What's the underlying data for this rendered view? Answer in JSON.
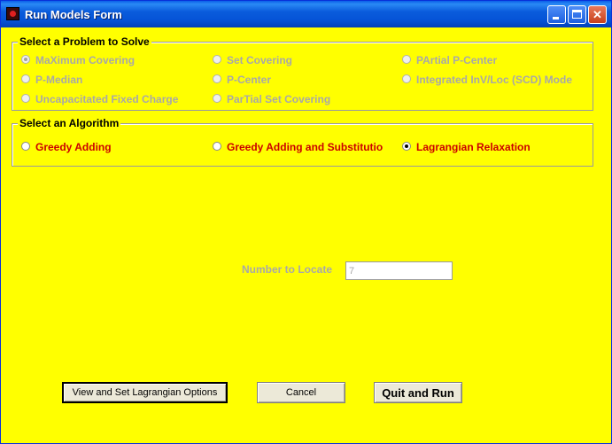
{
  "window": {
    "title": "Run Models Form"
  },
  "problem_group": {
    "legend": "Select a Problem to Solve",
    "options": [
      {
        "label": "MaXimum Covering",
        "checked": true
      },
      {
        "label": "Set Covering",
        "checked": false
      },
      {
        "label": "PArtial P-Center",
        "checked": false
      },
      {
        "label": "P-Median",
        "checked": false
      },
      {
        "label": "P-Center",
        "checked": false
      },
      {
        "label": "Integrated InV/Loc (SCD) Mode",
        "checked": false
      },
      {
        "label": "Uncapacitated Fixed Charge",
        "checked": false
      },
      {
        "label": "ParTial Set Covering",
        "checked": false
      }
    ]
  },
  "algorithm_group": {
    "legend": "Select an Algorithm",
    "options": [
      {
        "label": "Greedy Adding",
        "checked": false
      },
      {
        "label": "Greedy Adding and Substitutio",
        "checked": false
      },
      {
        "label": "Lagrangian Relaxation",
        "checked": true
      }
    ]
  },
  "number_to_locate": {
    "label": "Number to Locate",
    "value": "7"
  },
  "buttons": {
    "lagrangian_options": "View and Set Lagrangian Options",
    "cancel": "Cancel",
    "quit_and_run": "Quit and Run"
  },
  "colors": {
    "form_background": "#ffff00",
    "enabled_label": "#cc0000",
    "disabled_label": "#a8a8a8",
    "titlebar": "#0a5cdc"
  }
}
